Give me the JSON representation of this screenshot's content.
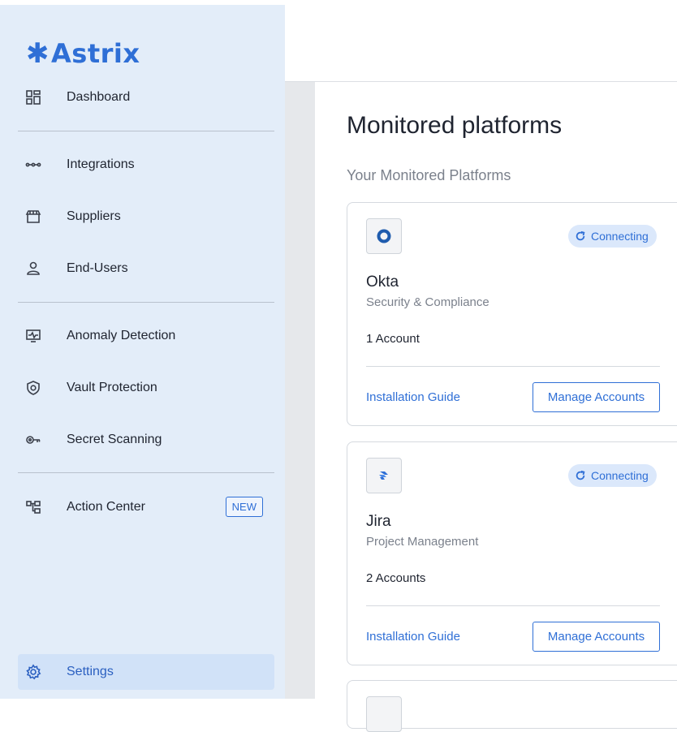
{
  "brand": {
    "name": "Astrix",
    "mark": "✱"
  },
  "nav": {
    "dashboard": {
      "label": "Dashboard",
      "icon": "dashboard-grid-icon"
    },
    "integrations": {
      "label": "Integrations",
      "icon": "integrations-dots-icon"
    },
    "suppliers": {
      "label": "Suppliers",
      "icon": "store-icon"
    },
    "end_users": {
      "label": "End-Users",
      "icon": "user-icon"
    },
    "anomaly": {
      "label": "Anomaly Detection",
      "icon": "pulse-monitor-icon"
    },
    "vault": {
      "label": "Vault Protection",
      "icon": "shield-icon"
    },
    "secret": {
      "label": "Secret Scanning",
      "icon": "key-icon"
    },
    "action": {
      "label": "Action Center",
      "icon": "flow-diagram-icon",
      "badge": "NEW"
    },
    "settings": {
      "label": "Settings",
      "icon": "gear-icon",
      "active": true
    }
  },
  "main": {
    "title": "Monitored platforms",
    "section_title": "Your Monitored Platforms",
    "cards": [
      {
        "name": "Okta",
        "category": "Security & Compliance",
        "accounts": "1 Account",
        "status": "Connecting",
        "guide": "Installation Guide",
        "manage": "Manage Accounts"
      },
      {
        "name": "Jira",
        "category": "Project Management",
        "accounts": "2 Accounts",
        "status": "Connecting",
        "guide": "Installation Guide",
        "manage": "Manage Accounts"
      }
    ]
  },
  "colors": {
    "accent": "#2f6fd6",
    "sidebar_bg": "#e3edf9",
    "status_bg": "#dbe8fb"
  }
}
